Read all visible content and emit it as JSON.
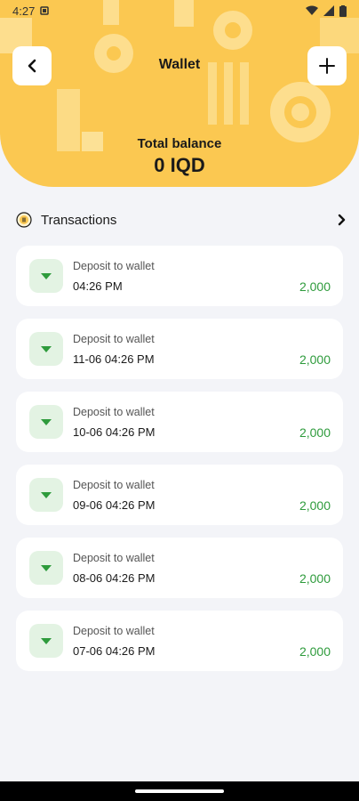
{
  "status_bar": {
    "time": "4:27"
  },
  "header": {
    "title": "Wallet",
    "balance_label": "Total balance",
    "balance_value": "0 IQD"
  },
  "transactions": {
    "heading": "Transactions",
    "items": [
      {
        "label": "Deposit to wallet",
        "time": "04:26 PM",
        "amount": "2,000"
      },
      {
        "label": "Deposit to wallet",
        "time": "11-06 04:26 PM",
        "amount": "2,000"
      },
      {
        "label": "Deposit to wallet",
        "time": "10-06 04:26 PM",
        "amount": "2,000"
      },
      {
        "label": "Deposit to wallet",
        "time": "09-06 04:26 PM",
        "amount": "2,000"
      },
      {
        "label": "Deposit to wallet",
        "time": "08-06 04:26 PM",
        "amount": "2,000"
      },
      {
        "label": "Deposit to wallet",
        "time": "07-06 04:26 PM",
        "amount": "2,000"
      }
    ]
  },
  "colors": {
    "header_bg": "#fbc851",
    "amount": "#2e9b3c",
    "icon_bg": "#e3f3e3"
  }
}
